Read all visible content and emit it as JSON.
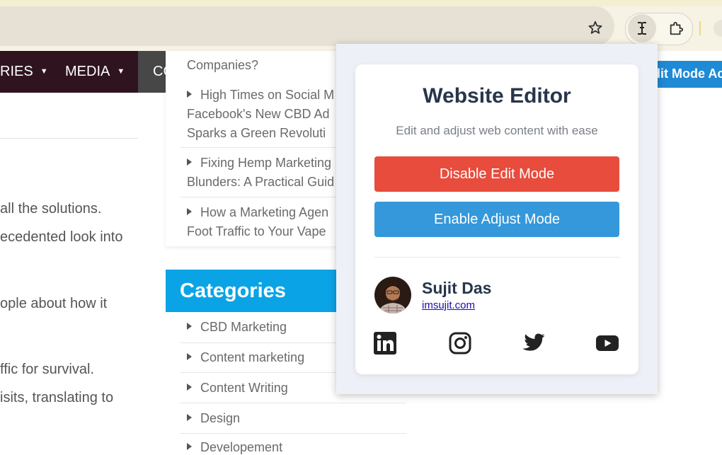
{
  "browser": {
    "bookmark_icon": "star-icon",
    "extension_icon": "cursor-text-icon",
    "extensions_menu_icon": "puzzle-icon"
  },
  "site_nav": {
    "items": [
      {
        "label": "RIES"
      },
      {
        "label": "MEDIA"
      },
      {
        "label": "CONTACT"
      }
    ],
    "right_button_label": "dit Mode Ac"
  },
  "article": {
    "lines": [
      "all the solutions.",
      "ecedented look into",
      "ople about how it",
      "ffic for survival.",
      "isits, translating to"
    ]
  },
  "recent_posts": {
    "items": [
      {
        "lines": [
          "Companies?"
        ]
      },
      {
        "lines": [
          "High Times on Social M",
          "Facebook's New CBD Ad",
          "Sparks a Green Revoluti"
        ]
      },
      {
        "lines": [
          "Fixing Hemp Marketing",
          "Blunders: A Practical Guid"
        ]
      },
      {
        "lines": [
          "How a Marketing Agen",
          "Foot Traffic to Your Vape"
        ]
      }
    ]
  },
  "categories": {
    "title": "Categories",
    "items": [
      "CBD Marketing",
      "Content marketing",
      "Content Writing",
      "Design",
      "Developement"
    ]
  },
  "popup": {
    "title": "Website Editor",
    "subtitle": "Edit and adjust web content with ease",
    "disable_edit_label": "Disable Edit Mode",
    "enable_adjust_label": "Enable Adjust Mode",
    "author": {
      "name": "Sujit Das",
      "link": "imsujit.com"
    },
    "socials": [
      "linkedin-icon",
      "instagram-icon",
      "twitter-icon",
      "youtube-icon"
    ]
  },
  "colors": {
    "accent_red": "#e74c3c",
    "accent_blue": "#3498db",
    "category_header": "#0aa4e6",
    "nav_dark": "#2f1420",
    "nav_gray": "#474747"
  }
}
